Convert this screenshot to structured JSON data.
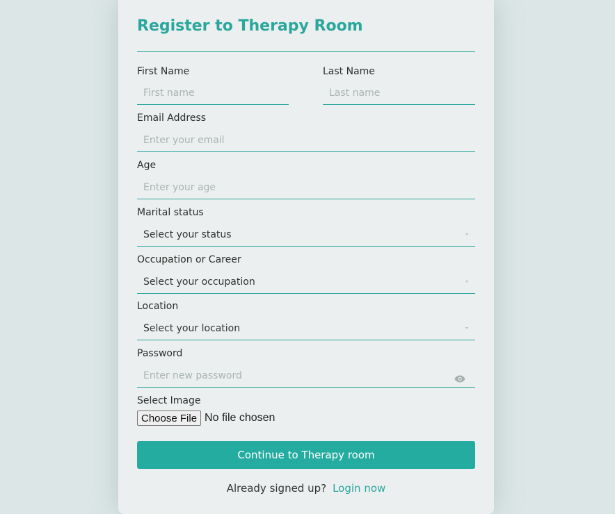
{
  "form": {
    "title": "Register to Therapy Room",
    "first_name": {
      "label": "First Name",
      "placeholder": "First name",
      "value": ""
    },
    "last_name": {
      "label": "Last Name",
      "placeholder": "Last name",
      "value": ""
    },
    "email": {
      "label": "Email Address",
      "placeholder": "Enter your email",
      "value": ""
    },
    "age": {
      "label": "Age",
      "placeholder": "Enter your age",
      "value": ""
    },
    "marital_status": {
      "label": "Marital status",
      "selected": "Select your status"
    },
    "occupation": {
      "label": "Occupation or Career",
      "selected": "Select your occupation"
    },
    "location": {
      "label": "Location",
      "selected": "Select your location"
    },
    "password": {
      "label": "Password",
      "placeholder": "Enter new password",
      "value": "",
      "toggle_icon": "eye-icon"
    },
    "image": {
      "label": "Select Image",
      "button_label": "Choose File",
      "status": "No file chosen"
    },
    "submit_label": "Continue to Therapy room",
    "footer_text": "Already signed up?",
    "login_link": "Login now"
  },
  "colors": {
    "accent": "#2aa79d",
    "button": "#24aca1",
    "page_bg": "#dce6e6",
    "card_bg": "#ecefef"
  }
}
